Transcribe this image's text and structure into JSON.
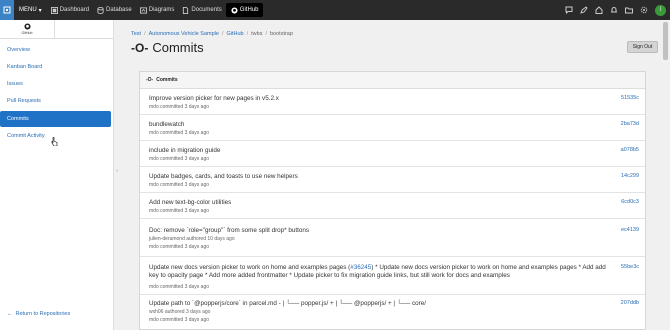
{
  "topbar": {
    "menu_label": "MENU",
    "nav": [
      {
        "label": "Dashboard",
        "icon": "dashboard-icon"
      },
      {
        "label": "Database",
        "icon": "database-icon"
      },
      {
        "label": "Diagrams",
        "icon": "diagram-icon"
      },
      {
        "label": "Documents",
        "icon": "document-icon"
      },
      {
        "label": "GitHub",
        "icon": "github-icon",
        "active": true
      }
    ],
    "avatar_initial": "I",
    "colors": {
      "bar": "#2a2a2a",
      "logo": "#3b83c4",
      "avatar": "#3a9a3a"
    }
  },
  "sidebar": {
    "tab_label": "GitHub",
    "items": [
      {
        "label": "Overview"
      },
      {
        "label": "Kanban Board"
      },
      {
        "label": "Issues"
      },
      {
        "label": "Pull Requests"
      },
      {
        "label": "Commits",
        "active": true
      },
      {
        "label": "Commit Activity"
      }
    ],
    "return_label": "Return to Repositories"
  },
  "breadcrumb": [
    "Test",
    "Autonomous Vehicle Sample",
    "GitHub",
    "twbs",
    "bootstrap"
  ],
  "page_title": "Commits",
  "signout_label": "Sign Out",
  "panel": {
    "heading": "Commits",
    "commits": [
      {
        "message": "Improve version picker for new pages in v5.2.x",
        "meta": "mdo committed 3 days ago",
        "sha": "51535c"
      },
      {
        "message": "bundlewatch",
        "meta": "mdo committed 3 days ago",
        "sha": "2ba73d"
      },
      {
        "message": "include in migration guide",
        "meta": "mdo committed 3 days ago",
        "sha": "a078b5"
      },
      {
        "message": "Update badges, cards, and toasts to use new helpers",
        "meta": "mdo committed 3 days ago",
        "sha": "14c299"
      },
      {
        "message": "Add new text-bg-color utilities",
        "meta": "mdo committed 3 days ago",
        "sha": "6cd0c3"
      },
      {
        "message": "Doc: remove `role=\"group\"` from some split drop* buttons",
        "meta": "julien-deramond authored 10 days ago",
        "meta2": "mdo committed 3 days ago",
        "sha": "ec4139"
      },
      {
        "message_pre": "Update new docs version picker to work on home and examples pages (",
        "message_link": "#36245",
        "message_post": ") * Update new docs version picker to work on home and examples pages * Add add key to opacity page * Add more added frontmatter * Update picker to fix migration guide links, but still work for docs and examples",
        "meta": "mdo committed 3 days ago",
        "sha": "55be3c"
      },
      {
        "message": "Update path to `@popperjs/core` in parcel.md - | └── popper.js/ + | └── @popperjs/ + | └── core/",
        "meta": "wxh06 authored 3 days ago",
        "meta2": "mdo committed 3 days ago",
        "sha": "207ddb"
      }
    ]
  }
}
